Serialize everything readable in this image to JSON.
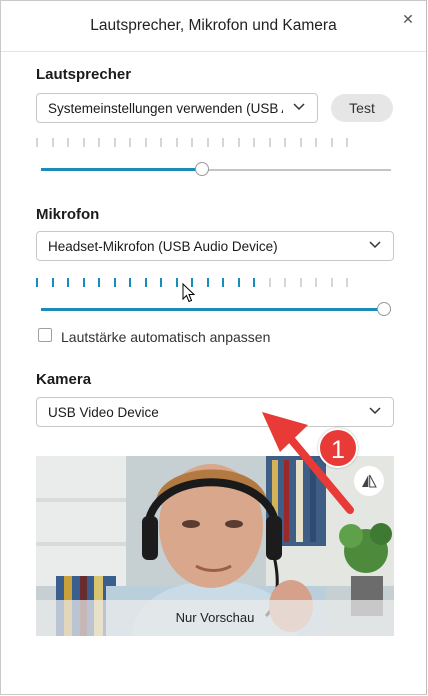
{
  "dialog": {
    "title": "Lautsprecher, Mikrofon und Kamera",
    "close_icon": "close-icon"
  },
  "speaker": {
    "label": "Lautsprecher",
    "device": "Systemeinstellungen verwenden (USB Audio Device)",
    "test_label": "Test",
    "meter_active_bars": 0,
    "meter_total_bars": 21,
    "volume_fraction": 0.46
  },
  "microphone": {
    "label": "Mikrofon",
    "device": "Headset-Mikrofon (USB Audio Device)",
    "meter_active_bars": 15,
    "meter_total_bars": 21,
    "volume_fraction": 1.0,
    "auto_adjust_label": "Lautstärke automatisch anpassen",
    "auto_adjust_checked": false
  },
  "camera": {
    "label": "Kamera",
    "device": "USB Video Device",
    "preview_label": "Nur Vorschau",
    "mirror_icon": "mirror-icon"
  },
  "annotation": {
    "badge": "1",
    "color": "#e83a36"
  },
  "colors": {
    "accent": "#1a8cba",
    "meter_off": "#d6d6d6"
  }
}
